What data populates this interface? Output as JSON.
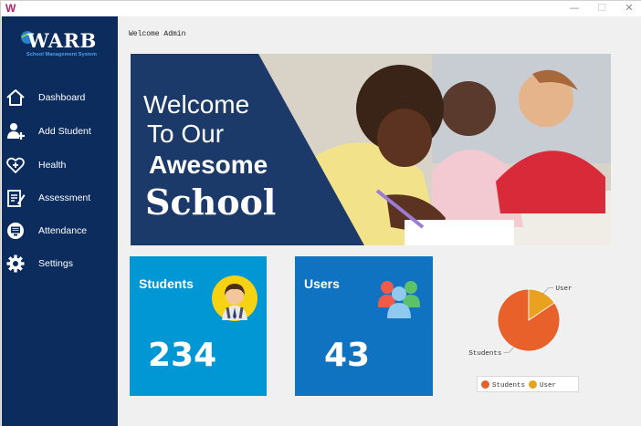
{
  "window": {
    "app_icon_letter": "W",
    "controls": {
      "minimize": "—",
      "maximize": "☐",
      "close": "✕"
    }
  },
  "sidebar": {
    "logo": {
      "title": "WARB",
      "subtitle": "School Management System"
    },
    "items": [
      {
        "label": "Dashboard",
        "icon": "home-icon"
      },
      {
        "label": "Add Student",
        "icon": "add-user-icon"
      },
      {
        "label": "Health",
        "icon": "heart-plus-icon"
      },
      {
        "label": "Assessment",
        "icon": "clipboard-pen-icon"
      },
      {
        "label": "Attendance",
        "icon": "monitor-icon"
      },
      {
        "label": "Settings",
        "icon": "gear-icon"
      }
    ]
  },
  "main": {
    "welcome": "Welcome Admin",
    "hero": {
      "line1": "Welcome",
      "line2": "To Our",
      "line3": "Awesome",
      "line4": "School"
    },
    "cards": [
      {
        "title": "Students",
        "value": "234",
        "icon": "student-avatar-icon"
      },
      {
        "title": "Users",
        "value": "43",
        "icon": "users-group-icon"
      }
    ]
  },
  "colors": {
    "sidebar": "#0d2c5e",
    "students_card": "#0097d4",
    "users_card": "#0f73c2",
    "pie_students": "#e8602a",
    "pie_user": "#e8a21f"
  },
  "chart_data": {
    "type": "pie",
    "slices": [
      {
        "label": "Students",
        "value": 234
      },
      {
        "label": "User",
        "value": 43
      }
    ],
    "legend": [
      "Students",
      "User"
    ],
    "legend_position": "bottom"
  }
}
